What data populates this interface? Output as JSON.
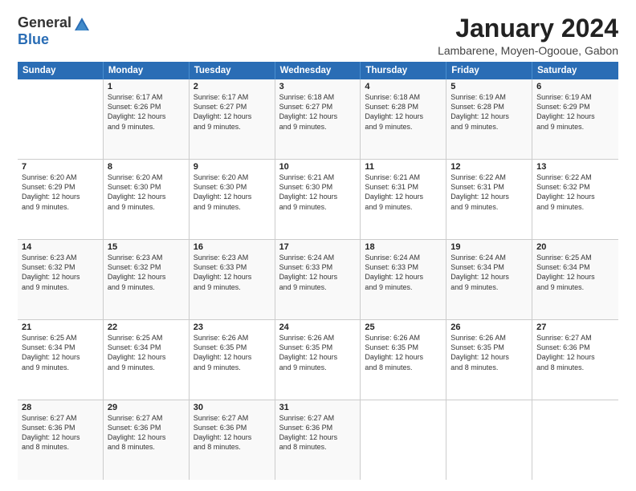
{
  "logo": {
    "general": "General",
    "blue": "Blue"
  },
  "title": "January 2024",
  "location": "Lambarene, Moyen-Ogooue, Gabon",
  "days": [
    "Sunday",
    "Monday",
    "Tuesday",
    "Wednesday",
    "Thursday",
    "Friday",
    "Saturday"
  ],
  "weeks": [
    [
      {
        "day": "",
        "sunrise": "",
        "sunset": "",
        "daylight": ""
      },
      {
        "day": "1",
        "sunrise": "6:17 AM",
        "sunset": "6:26 PM",
        "daylight": "12 hours and 9 minutes."
      },
      {
        "day": "2",
        "sunrise": "6:17 AM",
        "sunset": "6:27 PM",
        "daylight": "12 hours and 9 minutes."
      },
      {
        "day": "3",
        "sunrise": "6:18 AM",
        "sunset": "6:27 PM",
        "daylight": "12 hours and 9 minutes."
      },
      {
        "day": "4",
        "sunrise": "6:18 AM",
        "sunset": "6:28 PM",
        "daylight": "12 hours and 9 minutes."
      },
      {
        "day": "5",
        "sunrise": "6:19 AM",
        "sunset": "6:28 PM",
        "daylight": "12 hours and 9 minutes."
      },
      {
        "day": "6",
        "sunrise": "6:19 AM",
        "sunset": "6:29 PM",
        "daylight": "12 hours and 9 minutes."
      }
    ],
    [
      {
        "day": "7",
        "sunrise": "6:20 AM",
        "sunset": "6:29 PM",
        "daylight": "12 hours and 9 minutes."
      },
      {
        "day": "8",
        "sunrise": "6:20 AM",
        "sunset": "6:30 PM",
        "daylight": "12 hours and 9 minutes."
      },
      {
        "day": "9",
        "sunrise": "6:20 AM",
        "sunset": "6:30 PM",
        "daylight": "12 hours and 9 minutes."
      },
      {
        "day": "10",
        "sunrise": "6:21 AM",
        "sunset": "6:30 PM",
        "daylight": "12 hours and 9 minutes."
      },
      {
        "day": "11",
        "sunrise": "6:21 AM",
        "sunset": "6:31 PM",
        "daylight": "12 hours and 9 minutes."
      },
      {
        "day": "12",
        "sunrise": "6:22 AM",
        "sunset": "6:31 PM",
        "daylight": "12 hours and 9 minutes."
      },
      {
        "day": "13",
        "sunrise": "6:22 AM",
        "sunset": "6:32 PM",
        "daylight": "12 hours and 9 minutes."
      }
    ],
    [
      {
        "day": "14",
        "sunrise": "6:23 AM",
        "sunset": "6:32 PM",
        "daylight": "12 hours and 9 minutes."
      },
      {
        "day": "15",
        "sunrise": "6:23 AM",
        "sunset": "6:32 PM",
        "daylight": "12 hours and 9 minutes."
      },
      {
        "day": "16",
        "sunrise": "6:23 AM",
        "sunset": "6:33 PM",
        "daylight": "12 hours and 9 minutes."
      },
      {
        "day": "17",
        "sunrise": "6:24 AM",
        "sunset": "6:33 PM",
        "daylight": "12 hours and 9 minutes."
      },
      {
        "day": "18",
        "sunrise": "6:24 AM",
        "sunset": "6:33 PM",
        "daylight": "12 hours and 9 minutes."
      },
      {
        "day": "19",
        "sunrise": "6:24 AM",
        "sunset": "6:34 PM",
        "daylight": "12 hours and 9 minutes."
      },
      {
        "day": "20",
        "sunrise": "6:25 AM",
        "sunset": "6:34 PM",
        "daylight": "12 hours and 9 minutes."
      }
    ],
    [
      {
        "day": "21",
        "sunrise": "6:25 AM",
        "sunset": "6:34 PM",
        "daylight": "12 hours and 9 minutes."
      },
      {
        "day": "22",
        "sunrise": "6:25 AM",
        "sunset": "6:34 PM",
        "daylight": "12 hours and 9 minutes."
      },
      {
        "day": "23",
        "sunrise": "6:26 AM",
        "sunset": "6:35 PM",
        "daylight": "12 hours and 9 minutes."
      },
      {
        "day": "24",
        "sunrise": "6:26 AM",
        "sunset": "6:35 PM",
        "daylight": "12 hours and 9 minutes."
      },
      {
        "day": "25",
        "sunrise": "6:26 AM",
        "sunset": "6:35 PM",
        "daylight": "12 hours and 8 minutes."
      },
      {
        "day": "26",
        "sunrise": "6:26 AM",
        "sunset": "6:35 PM",
        "daylight": "12 hours and 8 minutes."
      },
      {
        "day": "27",
        "sunrise": "6:27 AM",
        "sunset": "6:36 PM",
        "daylight": "12 hours and 8 minutes."
      }
    ],
    [
      {
        "day": "28",
        "sunrise": "6:27 AM",
        "sunset": "6:36 PM",
        "daylight": "12 hours and 8 minutes."
      },
      {
        "day": "29",
        "sunrise": "6:27 AM",
        "sunset": "6:36 PM",
        "daylight": "12 hours and 8 minutes."
      },
      {
        "day": "30",
        "sunrise": "6:27 AM",
        "sunset": "6:36 PM",
        "daylight": "12 hours and 8 minutes."
      },
      {
        "day": "31",
        "sunrise": "6:27 AM",
        "sunset": "6:36 PM",
        "daylight": "12 hours and 8 minutes."
      },
      {
        "day": "",
        "sunrise": "",
        "sunset": "",
        "daylight": ""
      },
      {
        "day": "",
        "sunrise": "",
        "sunset": "",
        "daylight": ""
      },
      {
        "day": "",
        "sunrise": "",
        "sunset": "",
        "daylight": ""
      }
    ]
  ]
}
